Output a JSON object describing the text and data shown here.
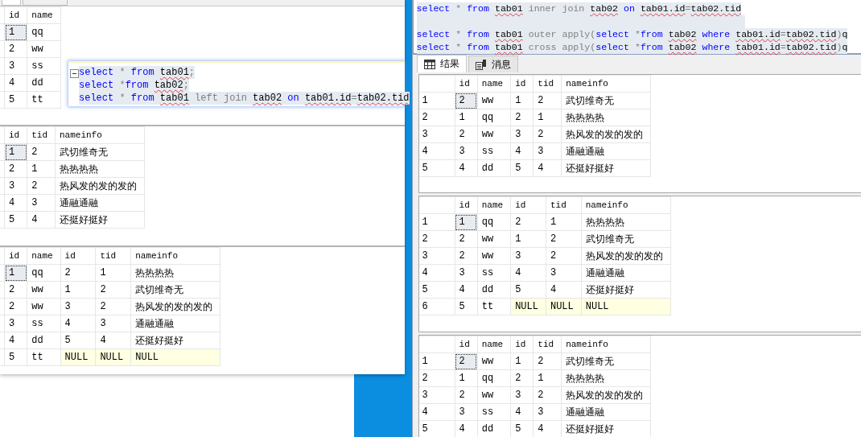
{
  "left_window": {
    "panes": [
      {
        "grid": {
          "columns": [
            "id",
            "name"
          ],
          "rows": [
            {
              "cells": [
                "1",
                "qq"
              ],
              "selected": true
            },
            {
              "cells": [
                "2",
                "ww"
              ],
              "selected": false
            },
            {
              "cells": [
                "3",
                "ss"
              ],
              "selected": false
            },
            {
              "cells": [
                "4",
                "dd"
              ],
              "selected": false
            },
            {
              "cells": [
                "5",
                "tt"
              ],
              "selected": false
            }
          ]
        }
      },
      {
        "grid": {
          "columns": [
            "id",
            "tid",
            "nameinfo"
          ],
          "rows": [
            {
              "cells": [
                "1",
                "2",
                "武切维奇无"
              ],
              "selected": true
            },
            {
              "cells": [
                "2",
                "1",
                "热热热热"
              ],
              "selected": false
            },
            {
              "cells": [
                "3",
                "2",
                "热风发的发的发的"
              ],
              "selected": false
            },
            {
              "cells": [
                "4",
                "3",
                "通融通融"
              ],
              "selected": false
            },
            {
              "cells": [
                "5",
                "4",
                "还挺好挺好"
              ],
              "selected": false
            }
          ]
        }
      },
      {
        "grid": {
          "columns": [
            "id",
            "name",
            "id",
            "tid",
            "nameinfo"
          ],
          "rows": [
            {
              "cells": [
                "1",
                "qq",
                "2",
                "1",
                "热热热热"
              ],
              "selected": true
            },
            {
              "cells": [
                "2",
                "ww",
                "1",
                "2",
                "武切维奇无"
              ],
              "selected": false
            },
            {
              "cells": [
                "2",
                "ww",
                "3",
                "2",
                "热风发的发的发的"
              ],
              "selected": false
            },
            {
              "cells": [
                "3",
                "ss",
                "4",
                "3",
                "通融通融"
              ],
              "selected": false
            },
            {
              "cells": [
                "4",
                "dd",
                "5",
                "4",
                "还挺好挺好"
              ],
              "selected": false
            },
            {
              "cells": [
                "5",
                "tt",
                "NULL",
                "NULL",
                "NULL"
              ],
              "selected": false,
              "null_cells": [
                false,
                false,
                true,
                true,
                true
              ]
            }
          ]
        }
      }
    ],
    "editor": {
      "lines": [
        {
          "selected": true,
          "tokens": [
            {
              "text": "select",
              "kind": "keyword"
            },
            {
              "text": " * ",
              "kind": "operator"
            },
            {
              "text": "from ",
              "kind": "keyword"
            },
            {
              "text": "tab01",
              "kind": "object"
            },
            {
              "text": ";",
              "kind": "operator"
            }
          ]
        },
        {
          "selected": true,
          "tokens": [
            {
              "text": "select",
              "kind": "keyword"
            },
            {
              "text": " *",
              "kind": "operator"
            },
            {
              "text": "from ",
              "kind": "keyword"
            },
            {
              "text": "tab02",
              "kind": "object"
            },
            {
              "text": ";",
              "kind": "operator"
            }
          ]
        },
        {
          "selected": true,
          "tokens": [
            {
              "text": "select",
              "kind": "keyword"
            },
            {
              "text": " * ",
              "kind": "operator"
            },
            {
              "text": "from ",
              "kind": "keyword"
            },
            {
              "text": "tab01",
              "kind": "object"
            },
            {
              "text": " left join ",
              "kind": "operator"
            },
            {
              "text": "tab02",
              "kind": "object"
            },
            {
              "text": " on ",
              "kind": "keyword"
            },
            {
              "text": "tab01.id",
              "kind": "object"
            },
            {
              "text": "=",
              "kind": "operator"
            },
            {
              "text": "tab02.tid",
              "kind": "object"
            }
          ]
        }
      ]
    }
  },
  "right_window": {
    "editor": {
      "lines": [
        {
          "selected": true,
          "tokens": [
            {
              "text": "select",
              "kind": "keyword"
            },
            {
              "text": " * ",
              "kind": "operator"
            },
            {
              "text": "from ",
              "kind": "keyword"
            },
            {
              "text": "tab01",
              "kind": "object"
            },
            {
              "text": " inner join ",
              "kind": "operator"
            },
            {
              "text": "tab02",
              "kind": "object"
            },
            {
              "text": " on ",
              "kind": "keyword"
            },
            {
              "text": "tab01.id",
              "kind": "object"
            },
            {
              "text": "=",
              "kind": "operator"
            },
            {
              "text": "tab02.tid",
              "kind": "object"
            }
          ]
        },
        {
          "selected": true
        },
        {
          "selected": true,
          "tokens": [
            {
              "text": "select",
              "kind": "keyword"
            },
            {
              "text": " * ",
              "kind": "operator"
            },
            {
              "text": "from ",
              "kind": "keyword"
            },
            {
              "text": "tab01",
              "kind": "object"
            },
            {
              "text": " outer apply(",
              "kind": "operator"
            },
            {
              "text": "select",
              "kind": "keyword"
            },
            {
              "text": " *",
              "kind": "operator"
            },
            {
              "text": "from ",
              "kind": "keyword"
            },
            {
              "text": "tab02",
              "kind": "object"
            },
            {
              "text": " where ",
              "kind": "keyword"
            },
            {
              "text": "tab01.id",
              "kind": "object"
            },
            {
              "text": "=",
              "kind": "operator"
            },
            {
              "text": "tab02.tid",
              "kind": "object"
            },
            {
              "text": ")",
              "kind": "operator"
            },
            {
              "text": "q",
              "kind": "plain"
            }
          ]
        },
        {
          "selected": true,
          "tokens": [
            {
              "text": "select",
              "kind": "keyword"
            },
            {
              "text": " * ",
              "kind": "operator"
            },
            {
              "text": "from ",
              "kind": "keyword"
            },
            {
              "text": "tab01",
              "kind": "object"
            },
            {
              "text": " cross apply(",
              "kind": "operator"
            },
            {
              "text": "select",
              "kind": "keyword"
            },
            {
              "text": " *",
              "kind": "operator"
            },
            {
              "text": "from ",
              "kind": "keyword"
            },
            {
              "text": "tab02",
              "kind": "object"
            },
            {
              "text": " where ",
              "kind": "keyword"
            },
            {
              "text": "tab01.id",
              "kind": "object"
            },
            {
              "text": "=",
              "kind": "operator"
            },
            {
              "text": "tab02.tid",
              "kind": "object"
            },
            {
              "text": ")",
              "kind": "operator"
            },
            {
              "text": "q",
              "kind": "plain"
            }
          ]
        }
      ]
    },
    "tabs": [
      {
        "label": "结果",
        "selected": true,
        "kind": "grid"
      },
      {
        "label": "消息",
        "selected": false,
        "kind": "messages"
      }
    ],
    "grids": [
      {
        "columns": [
          "id",
          "name",
          "id",
          "tid",
          "nameinfo"
        ],
        "rows": [
          {
            "number": "1",
            "cells": [
              "2",
              "ww",
              "1",
              "2",
              "武切维奇无"
            ],
            "selected": true
          },
          {
            "number": "2",
            "cells": [
              "1",
              "qq",
              "2",
              "1",
              "热热热热"
            ],
            "selected": false
          },
          {
            "number": "3",
            "cells": [
              "2",
              "ww",
              "3",
              "2",
              "热风发的发的发的"
            ],
            "selected": false
          },
          {
            "number": "4",
            "cells": [
              "3",
              "ss",
              "4",
              "3",
              "通融通融"
            ],
            "selected": false
          },
          {
            "number": "5",
            "cells": [
              "4",
              "dd",
              "5",
              "4",
              "还挺好挺好"
            ],
            "selected": false
          }
        ]
      },
      {
        "columns": [
          "id",
          "name",
          "id",
          "tid",
          "nameinfo"
        ],
        "rows": [
          {
            "number": "1",
            "cells": [
              "1",
              "qq",
              "2",
              "1",
              "热热热热"
            ],
            "selected": true
          },
          {
            "number": "2",
            "cells": [
              "2",
              "ww",
              "1",
              "2",
              "武切维奇无"
            ],
            "selected": false
          },
          {
            "number": "3",
            "cells": [
              "2",
              "ww",
              "3",
              "2",
              "热风发的发的发的"
            ],
            "selected": false
          },
          {
            "number": "4",
            "cells": [
              "3",
              "ss",
              "4",
              "3",
              "通融通融"
            ],
            "selected": false
          },
          {
            "number": "5",
            "cells": [
              "4",
              "dd",
              "5",
              "4",
              "还挺好挺好"
            ],
            "selected": false
          },
          {
            "number": "6",
            "cells": [
              "5",
              "tt",
              "NULL",
              "NULL",
              "NULL"
            ],
            "selected": false,
            "null_cells": [
              false,
              false,
              true,
              true,
              true
            ]
          }
        ]
      },
      {
        "columns": [
          "id",
          "name",
          "id",
          "tid",
          "nameinfo"
        ],
        "rows": [
          {
            "number": "1",
            "cells": [
              "2",
              "ww",
              "1",
              "2",
              "武切维奇无"
            ],
            "selected": true
          },
          {
            "number": "2",
            "cells": [
              "1",
              "qq",
              "2",
              "1",
              "热热热热"
            ],
            "selected": false
          },
          {
            "number": "3",
            "cells": [
              "2",
              "ww",
              "3",
              "2",
              "热风发的发的发的"
            ],
            "selected": false
          },
          {
            "number": "4",
            "cells": [
              "3",
              "ss",
              "4",
              "3",
              "通融通融"
            ],
            "selected": false
          },
          {
            "number": "5",
            "cells": [
              "4",
              "dd",
              "5",
              "4",
              "还挺好挺好"
            ],
            "selected": false
          }
        ]
      }
    ]
  }
}
